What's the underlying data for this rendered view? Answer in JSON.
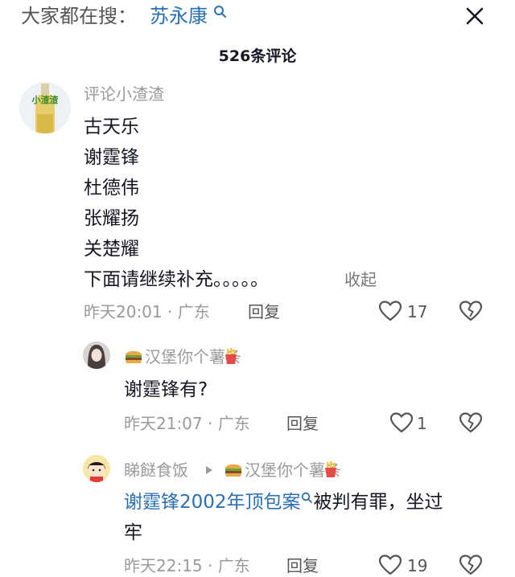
{
  "header": {
    "search_prefix": "大家都在搜：",
    "search_term": "苏永康",
    "comment_count_title": "526条评论"
  },
  "comments": [
    {
      "username": "评论小渣渣",
      "avatar_text": "小渣渣",
      "lines": [
        "古天乐",
        "谢霆锋",
        "杜德伟",
        "张耀扬",
        "关楚耀",
        "下面请继续补充。。。。。"
      ],
      "collapse_label": "收起",
      "time_location": "昨天20:01 · 广东",
      "reply_label": "回复",
      "like_count": "17"
    }
  ],
  "replies": [
    {
      "username": "汉堡你个薯条",
      "text": "谢霆锋有?",
      "time_location": "昨天21:07 · 广东",
      "reply_label": "回复",
      "like_count": "1"
    },
    {
      "username": "睇餸食饭",
      "reply_to": "汉堡你个薯条",
      "link_text": "谢霆锋2002年顶包案",
      "text_after_link": "被判有罪，坐过",
      "text_line2": "牢",
      "time_location": "昨天22:15 · 广东",
      "reply_label": "回复",
      "like_count": "19"
    }
  ],
  "colors": {
    "link": "#2a6fb3",
    "muted": "#9a9a9a",
    "text": "#161823"
  },
  "icons": [
    "search-icon",
    "close-icon",
    "heart-icon",
    "dislike-heart-icon",
    "burger-emoji",
    "fries-emoji",
    "play-arrow-icon"
  ]
}
